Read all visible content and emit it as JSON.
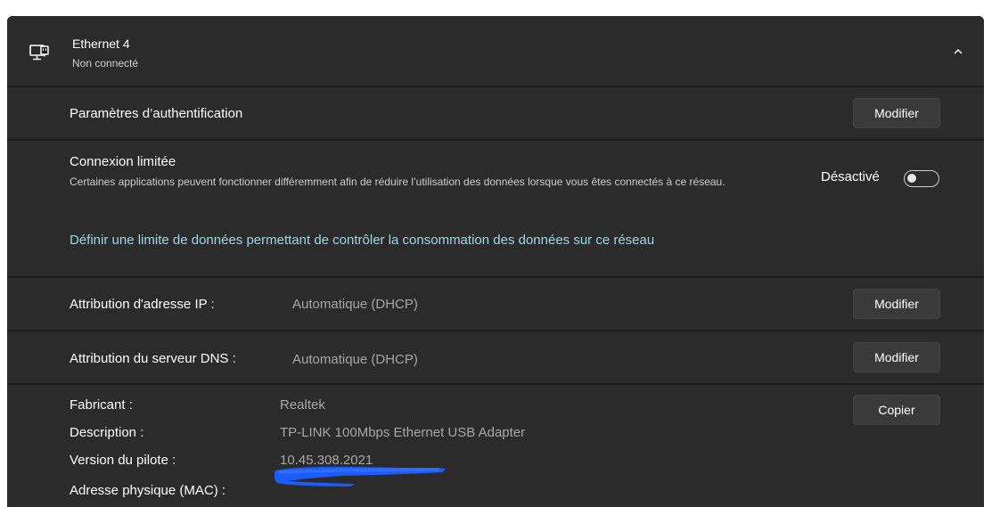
{
  "adapter": {
    "title": "Ethernet 4",
    "status": "Non connecté"
  },
  "auth": {
    "label": "Paramètres d’authentification",
    "button": "Modifier"
  },
  "metered": {
    "title": "Connexion limitée",
    "description": "Certaines applications peuvent fonctionner différemment afin de réduire l’utilisation des données lorsque vous êtes connectés à ce réseau.",
    "toggle_label": "Désactivé",
    "toggle_on": false,
    "data_limit_link": "Définir une limite de données permettant de contrôler la consommation des données sur ce réseau"
  },
  "ip": {
    "label": "Attribution d'adresse IP :",
    "value": "Automatique (DHCP)",
    "button": "Modifier"
  },
  "dns": {
    "label": "Attribution du serveur DNS :",
    "value": "Automatique (DHCP)",
    "button": "Modifier"
  },
  "properties": {
    "copy_button": "Copier",
    "items": [
      {
        "label": "Fabricant :",
        "value": "Realtek"
      },
      {
        "label": "Description :",
        "value": "TP-LINK 100Mbps Ethernet USB Adapter"
      },
      {
        "label": "Version du pilote :",
        "value": "10.45.308.2021"
      },
      {
        "label": "Adresse physique (MAC) :",
        "value": ""
      }
    ]
  },
  "colors": {
    "panel_bg": "#202020",
    "row_bg": "#2b2b2b",
    "link": "#9ed8e6",
    "redaction": "#1a5cff"
  }
}
